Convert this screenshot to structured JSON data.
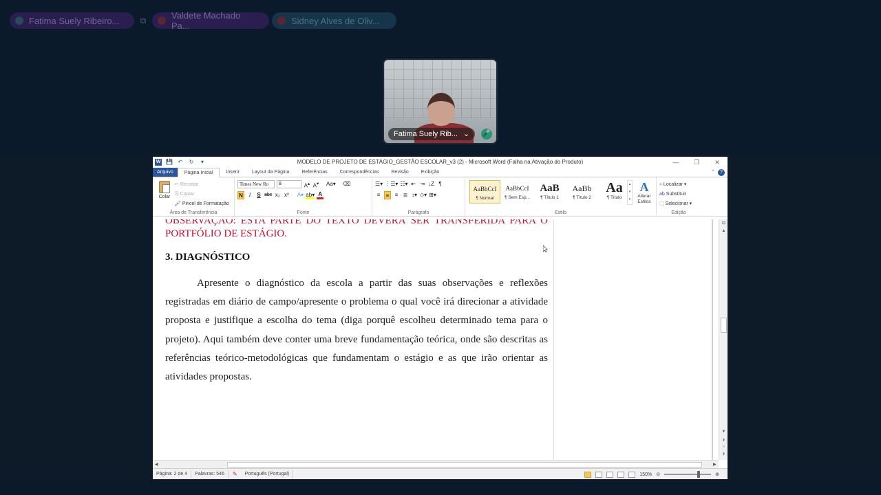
{
  "meeting": {
    "participants": [
      {
        "name": "Fatima Suely Ribeiro...",
        "color": "purple"
      },
      {
        "name": "Valdete Machado Pa...",
        "color": "purple"
      },
      {
        "name": "Sidney Alves de Oliv...",
        "color": "teal"
      }
    ],
    "video_tile_name": "Fatima Suely Rib...",
    "separator_icon": "screen-icon"
  },
  "word": {
    "title": "MODELO DE PROJETO DE ESTÁGIO_GESTÃO ESCOLAR_v3 (2)  -  Microsoft Word (Falha na Ativação do Produto)",
    "tabs": [
      "Arquivo",
      "Página Inicial",
      "Inserir",
      "Layout da Página",
      "Referências",
      "Correspondências",
      "Revisão",
      "Exibição"
    ],
    "clipboard": {
      "paste": "Colar",
      "cut": "Recortar",
      "copy": "Copiar",
      "format_painter": "Pincel de Formatação",
      "label": "Área de Transferência"
    },
    "font": {
      "name": "Times New Ro",
      "size": "8",
      "label": "Fonte"
    },
    "paragraph_label": "Parágrafo",
    "styles": {
      "items": [
        {
          "sample": "AaBbCcI",
          "label": "¶ Normal"
        },
        {
          "sample": "AaBbCcI",
          "label": "¶ Sem Esp..."
        },
        {
          "sample": "AaB",
          "label": "¶ Título 1"
        },
        {
          "sample": "AaBb",
          "label": "¶ Título 2"
        },
        {
          "sample": "Aa",
          "label": "¶ Título"
        }
      ],
      "change_styles": "Alterar Estilos",
      "label": "Estilo"
    },
    "editing": {
      "find": "Localizar",
      "replace": "Substituir",
      "select": "Selecionar",
      "label": "Edição"
    },
    "document": {
      "observation": "OBSERVAÇÃO: ESTA PARTE DO TEXTO DEVERÁ SER TRANSFERIDA PARA O PORTFÓLIO DE ESTÁGIO.",
      "heading": "3. DIAGNÓSTICO",
      "body": "Apresente o diagnóstico da escola a partir das suas observações e reflexões registradas em diário de campo/apresente o problema o qual você irá direcionar a atividade proposta e justifique a escolha do tema (diga porquê escolheu determinado tema para o projeto). Aqui também deve conter uma breve fundamentação teórica, onde são descritas as referências teórico-metodológicas que fundamentam o estágio e as que irão orientar as atividades propostas."
    },
    "status": {
      "page": "Página: 2 de 4",
      "words": "Palavras: 546",
      "language": "Português (Portugal)",
      "zoom": "150%"
    }
  }
}
